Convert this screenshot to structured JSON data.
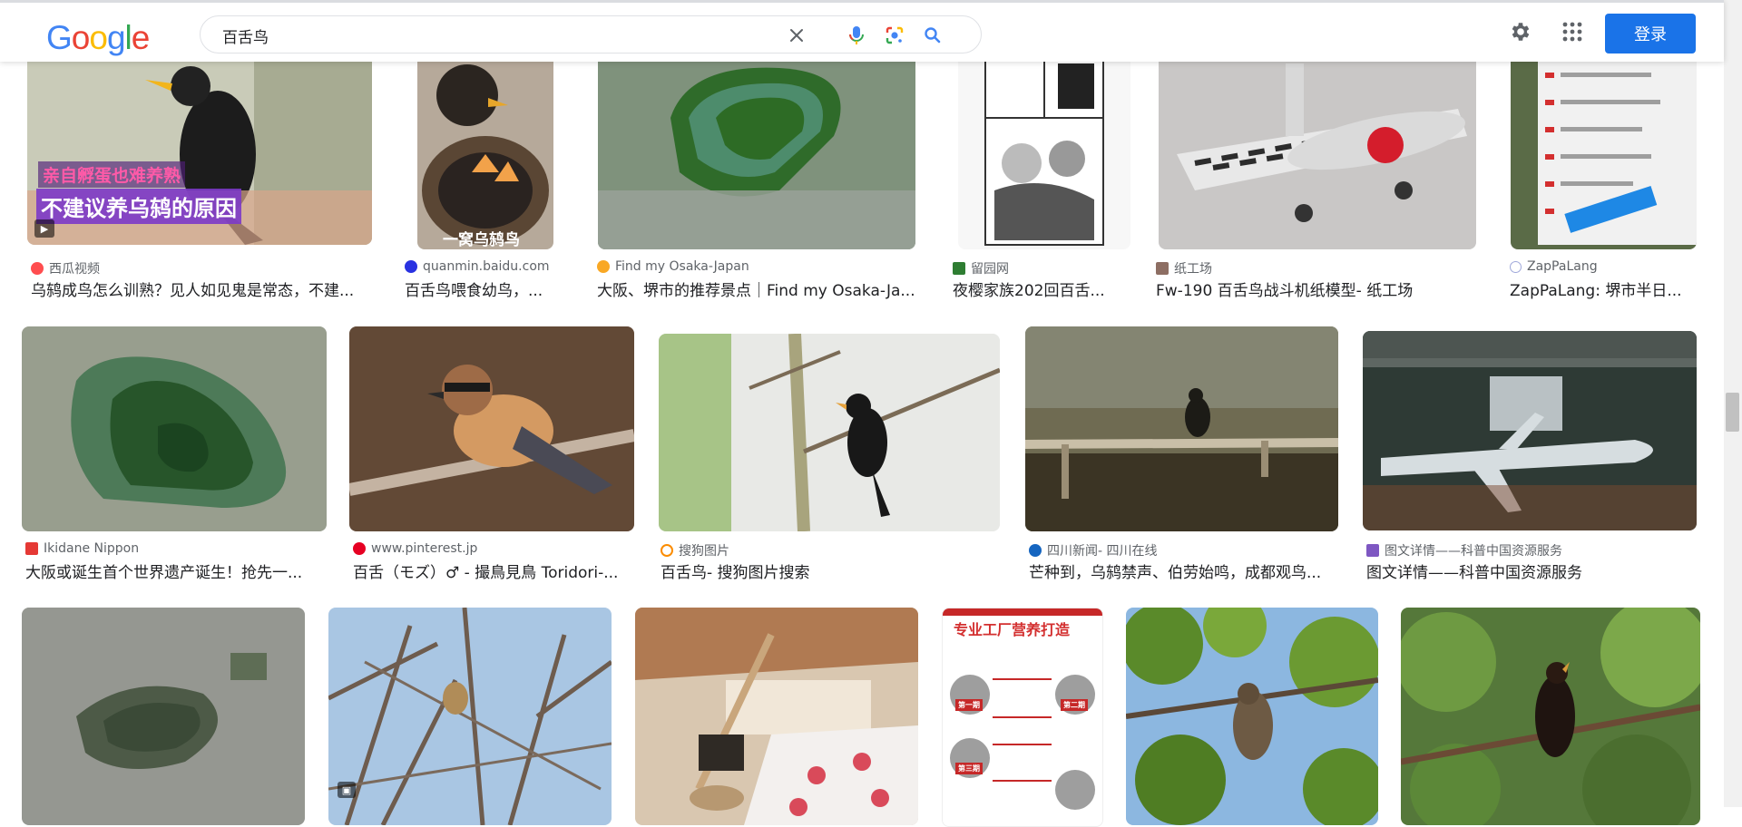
{
  "header": {
    "logo": {
      "letters": [
        "G",
        "o",
        "o",
        "g",
        "l",
        "e"
      ],
      "colors": [
        "#4285F4",
        "#EA4335",
        "#FBBC05",
        "#4285F4",
        "#34A853",
        "#EA4335"
      ]
    },
    "search_value": "百舌鸟",
    "login_label": "登录"
  },
  "colors": {
    "accent": "#1a73e8",
    "border": "#dfe1e5"
  },
  "results": [
    {
      "source": "西瓜视频",
      "title": "乌鸫成鸟怎么训熟？见人如见鬼是常态，不建...",
      "favicon": "#ff4d4f",
      "image": "blackbird-video",
      "overlay": [
        "亲自孵蛋也难养熟",
        "不建议养乌鸫的原因"
      ],
      "badge": "video"
    },
    {
      "source": "quanmin.baidu.com",
      "title": "百舌鸟喂食幼鸟，...",
      "favicon": "#2932e1",
      "image": "nest-chicks",
      "overlay": [
        "一窝乌鸫鸟"
      ]
    },
    {
      "source": "Find my Osaka-Japan",
      "title": "大阪、堺市的推荐景点｜Find my Osaka-Ja...",
      "favicon": "#f9a825",
      "image": "kofun-aerial"
    },
    {
      "source": "留园网",
      "title": "夜樱家族202回百舌...",
      "favicon": "#2e7d32",
      "image": "manga-page"
    },
    {
      "source": "纸工场",
      "title": "Fw-190 百舌鸟战斗机纸模型- 纸工场",
      "favicon": "#8d6e63",
      "image": "paper-plane"
    },
    {
      "source": "ZapPaLang",
      "title": "ZapPaLang: 堺市半日...",
      "favicon": "#9fa8da",
      "image": "sign-board"
    },
    {
      "source": "Ikidane Nippon",
      "title": "大阪或诞生首个世界遗产诞生！抢先一...",
      "favicon": "#e53935",
      "image": "kofun-aerial-2"
    },
    {
      "source": "www.pinterest.jp",
      "title": "百舌（モズ）♂ - 撮鳥見鳥 Toridori-...",
      "favicon": "#e60023",
      "image": "shrike"
    },
    {
      "source": "搜狗图片",
      "title": "百舌鸟- 搜狗图片搜索",
      "favicon": "#fb8c00",
      "image": "blackbird-branch"
    },
    {
      "source": "四川新闻- 四川在线",
      "title": "芒种到，乌鸫禁声、伯劳始鸣，成都观鸟...",
      "favicon": "#1565c0",
      "image": "bird-fence"
    },
    {
      "source": "图文详情——科普中国资源服务",
      "title": "图文详情——科普中国资源服务",
      "favicon": "#7e57c2",
      "image": "missile"
    },
    {
      "source": "",
      "title": "",
      "image": "city-aerial"
    },
    {
      "source": "",
      "title": "",
      "image": "winter-branches",
      "badge": "image"
    },
    {
      "source": "",
      "title": "",
      "image": "room-interior"
    },
    {
      "source": "",
      "title": "",
      "image": "factory-ad",
      "overlay": [
        "专业工厂营养打造",
        "第一期",
        "第二期",
        "第三期"
      ]
    },
    {
      "source": "",
      "title": "",
      "image": "bird-leaves"
    },
    {
      "source": "",
      "title": "",
      "image": "blackbird-tree"
    }
  ]
}
